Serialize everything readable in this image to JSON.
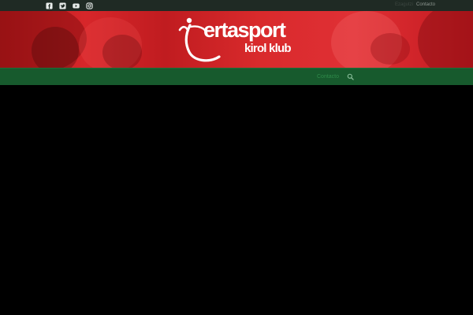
{
  "topbar": {
    "social_icons": [
      "facebook-icon",
      "twitter-icon",
      "youtube-icon",
      "instagram-icon"
    ],
    "links": [
      "Ezagutzi",
      "Contacto"
    ]
  },
  "banner": {
    "logo_word": "ertasport",
    "logo_sub": "kirol klub"
  },
  "nav": {
    "items": [
      "Contacto"
    ],
    "search_icon": "search-icon"
  },
  "colors": {
    "topbar_bg": "#1f2a24",
    "banner_red": "#d7262a",
    "nav_green": "#175a2d",
    "page_bg": "#000000"
  }
}
